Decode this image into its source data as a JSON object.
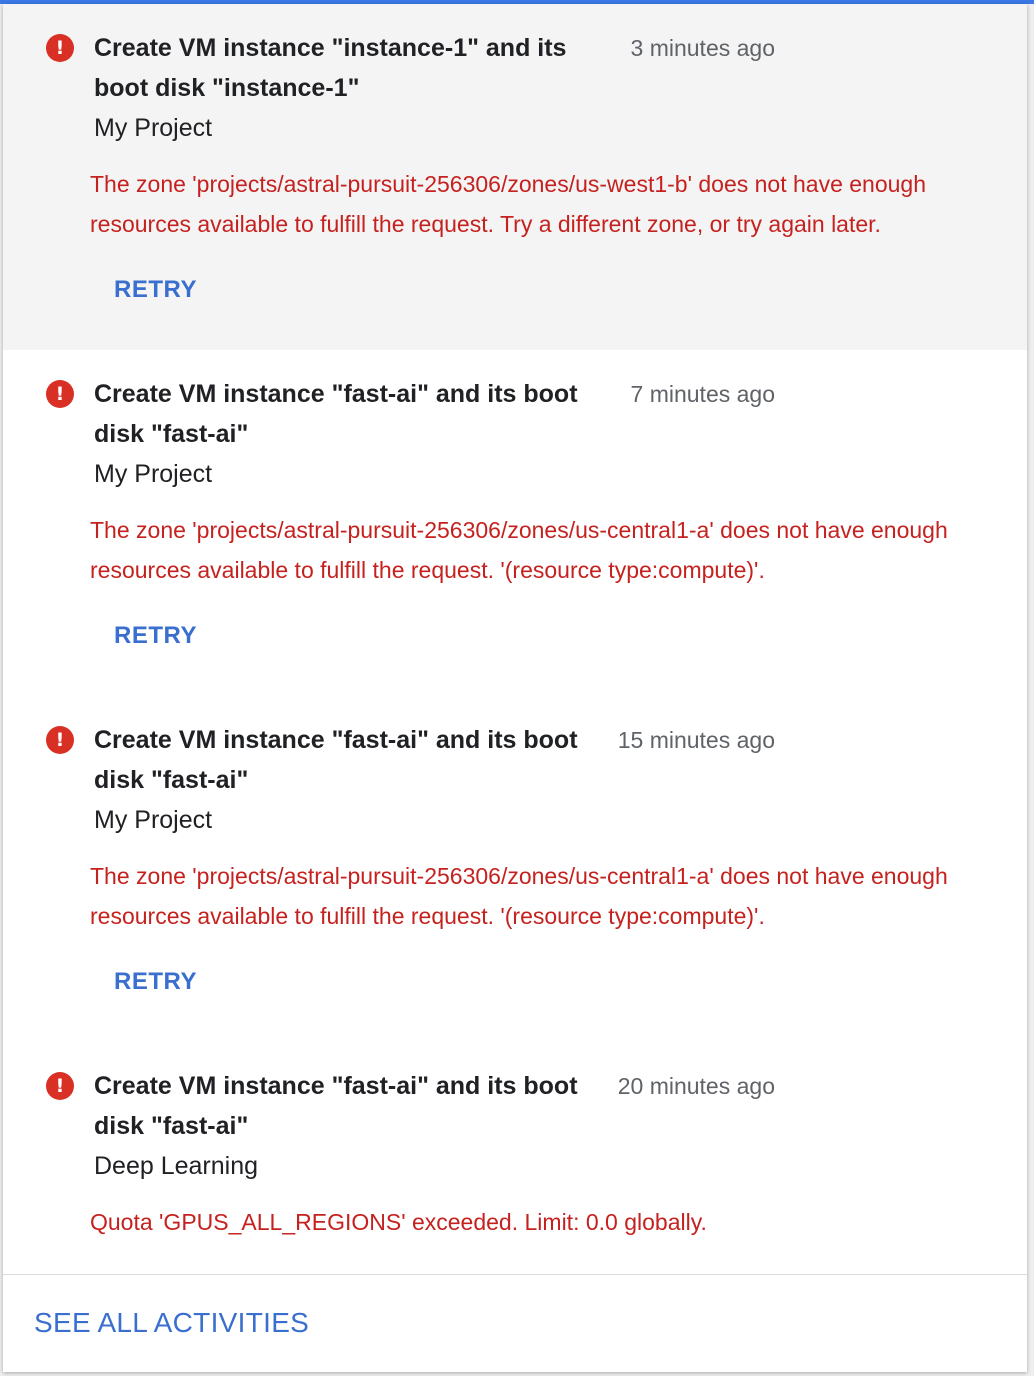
{
  "colors": {
    "error": "#c5221f",
    "error_icon": "#d93025",
    "link": "#3a6fd0",
    "accent": "#3b78e7",
    "highlight_bg": "#f4f4f4"
  },
  "activities": [
    {
      "icon": "error-icon",
      "title": "Create VM instance \"instance-1\" and its boot disk \"instance-1\"",
      "time": "3 minutes ago",
      "project": "My Project",
      "message": "The zone 'projects/astral-pursuit-256306/zones/us-west1-b' does not have enough resources available to fulfill the request. Try a different zone, or try again later.",
      "action": "RETRY"
    },
    {
      "icon": "error-icon",
      "title": "Create VM instance \"fast-ai\" and its boot disk \"fast-ai\"",
      "time": "7 minutes ago",
      "project": "My Project",
      "message": "The zone 'projects/astral-pursuit-256306/zones/us-central1-a' does not have enough resources available to fulfill the request. '(resource type:compute)'.",
      "action": "RETRY"
    },
    {
      "icon": "error-icon",
      "title": "Create VM instance \"fast-ai\" and its boot disk \"fast-ai\"",
      "time": "15 minutes ago",
      "project": "My Project",
      "message": "The zone 'projects/astral-pursuit-256306/zones/us-central1-a' does not have enough resources available to fulfill the request. '(resource type:compute)'.",
      "action": "RETRY"
    },
    {
      "icon": "error-icon",
      "title": "Create VM instance \"fast-ai\" and its boot disk \"fast-ai\"",
      "time": "20 minutes ago",
      "project": "Deep Learning",
      "message": "Quota 'GPUS_ALL_REGIONS' exceeded. Limit: 0.0 globally."
    }
  ],
  "footer": {
    "see_all_label": "SEE ALL ACTIVITIES"
  }
}
